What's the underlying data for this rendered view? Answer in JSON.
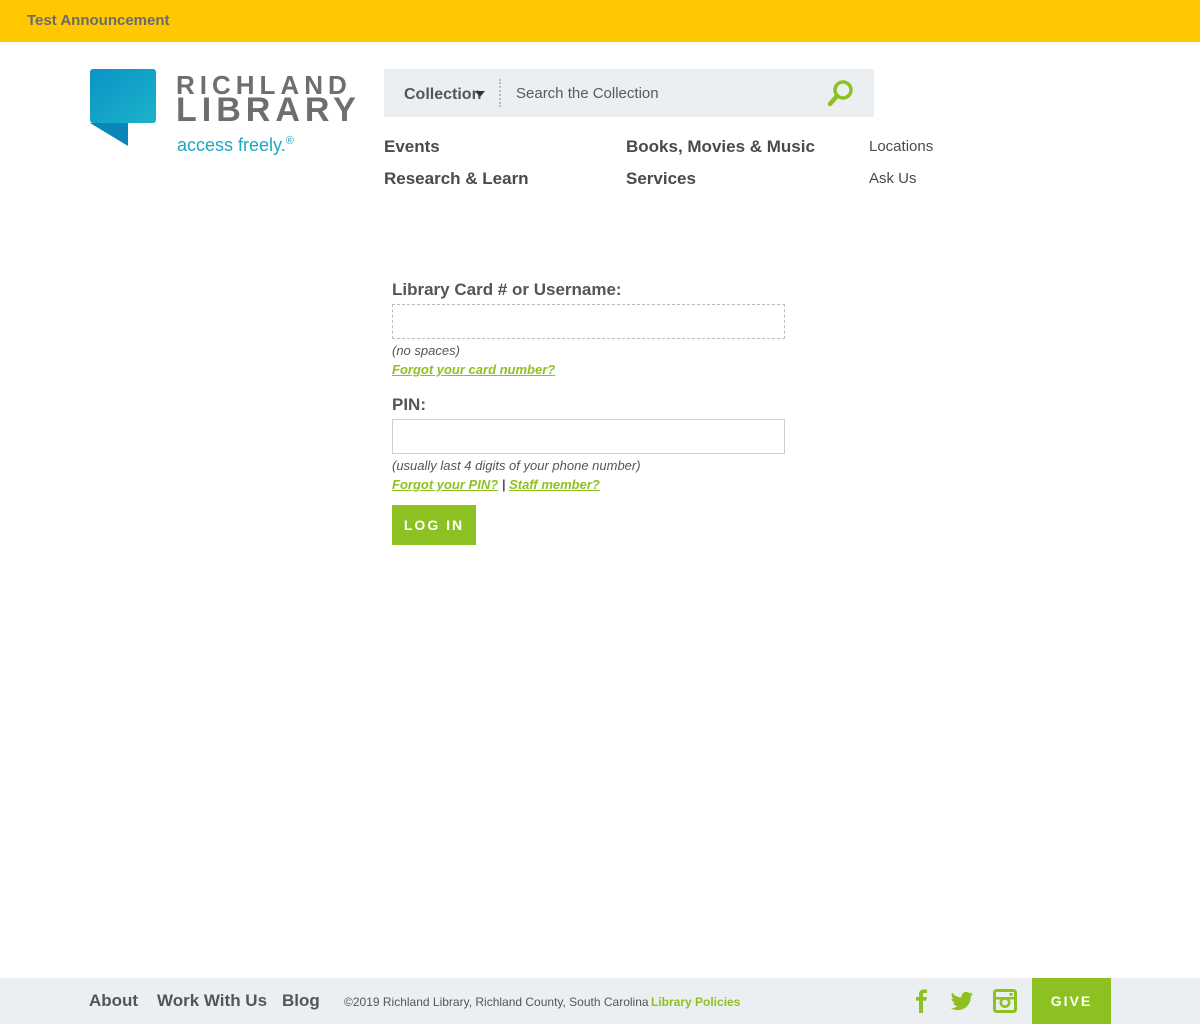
{
  "announcement": {
    "text": "Test Announcement"
  },
  "brand": {
    "name_line1": "RICHLAND",
    "name_line2": "LIBRARY",
    "tagline": "access freely.",
    "tagline_mark": "®",
    "mark_color": "#1aa7c2"
  },
  "search": {
    "type_label": "Collection",
    "placeholder": "Search the Collection",
    "button_icon": "search-icon"
  },
  "nav": {
    "primary": [
      "Events",
      "Books, Movies & Music",
      "Research & Learn",
      "Services"
    ],
    "secondary": [
      "Locations",
      "Ask Us"
    ]
  },
  "login": {
    "card_label": "Library Card # or Username:",
    "card_value": "",
    "card_hint": "(no spaces)",
    "forgot_card": "Forgot your card number?",
    "pin_label": "PIN:",
    "pin_value": "",
    "pin_hint": "(usually last 4 digits of your phone number)",
    "forgot_pin": "Forgot your PIN?",
    "separator": "|",
    "staff_member": "Staff member?",
    "submit_label": "LOG IN"
  },
  "footer": {
    "links": [
      "About",
      "Work With Us",
      "Blog"
    ],
    "copyright": "©2019 Richland Library, Richland County, South Carolina",
    "policies": "Library Policies",
    "social_icons": [
      "facebook-icon",
      "twitter-icon",
      "instagram-icon"
    ],
    "give_label": "GIVE"
  },
  "colors": {
    "announcement_bg": "#ffc800",
    "accent_green": "#8dc121",
    "brand_teal": "#1aa7c2",
    "panel_gray": "#eceff1"
  }
}
